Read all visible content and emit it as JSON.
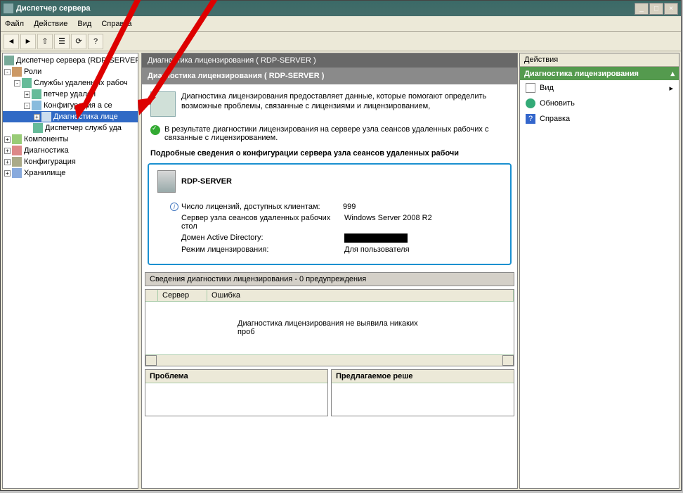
{
  "window": {
    "title": "Диспетчер сервера"
  },
  "menu": {
    "file": "Файл",
    "action": "Действие",
    "view": "Вид",
    "help": "Справка"
  },
  "tree": {
    "root": "Диспетчер сервера (RDP-SERVER)",
    "roles": "Роли",
    "remote_services": "Службы удаленных рабоч",
    "remote_dispatcher": "петчер удален",
    "config_node": "Конфигурация        а се",
    "diag_lic": "Диагностика лице",
    "dispatcher_services": "Диспетчер служб уда",
    "components": "Компоненты",
    "diagnostics": "Диагностика",
    "config": "Конфигурация",
    "storage": "Хранилище"
  },
  "center": {
    "breadcrumb": "Диагностика лицензирования   ( RDP-SERVER )",
    "title": "Диагностика лицензирования ( RDP-SERVER )",
    "intro": "Диагностика лицензирования предоставляет данные, которые помогают определить возможные проблемы, связанные с лицензиями и лицензированием,",
    "result": "В результате диагностики лицензирования на сервере узла сеансов удаленных рабочих с связанные с лицензированием.",
    "details_title": "Подробные сведения о конфигурации сервера узла сеансов удаленных рабочи",
    "server_name": "RDP-SERVER",
    "lic_count_label": "Число лицензий, доступных клиентам:",
    "lic_count": "999",
    "session_host_label": "Сервер узла сеансов удаленных рабочих стол",
    "session_host_value": "Windows Server 2008 R2",
    "domain_label": "Домен Active Directory:",
    "mode_label": "Режим лицензирования:",
    "mode_value": "Для пользователя",
    "diag_section": "Сведения диагностики лицензирования - 0 предупреждения",
    "col_server": "Сервер",
    "col_error": "Ошибка",
    "no_diag": "Диагностика лицензирования не выявила никаких проб",
    "problem": "Проблема",
    "solution": "Предлагаемое реше"
  },
  "actions": {
    "header": "Действия",
    "group": "Диагностика лицензирования",
    "view": "Вид",
    "refresh": "Обновить",
    "help": "Справка"
  }
}
